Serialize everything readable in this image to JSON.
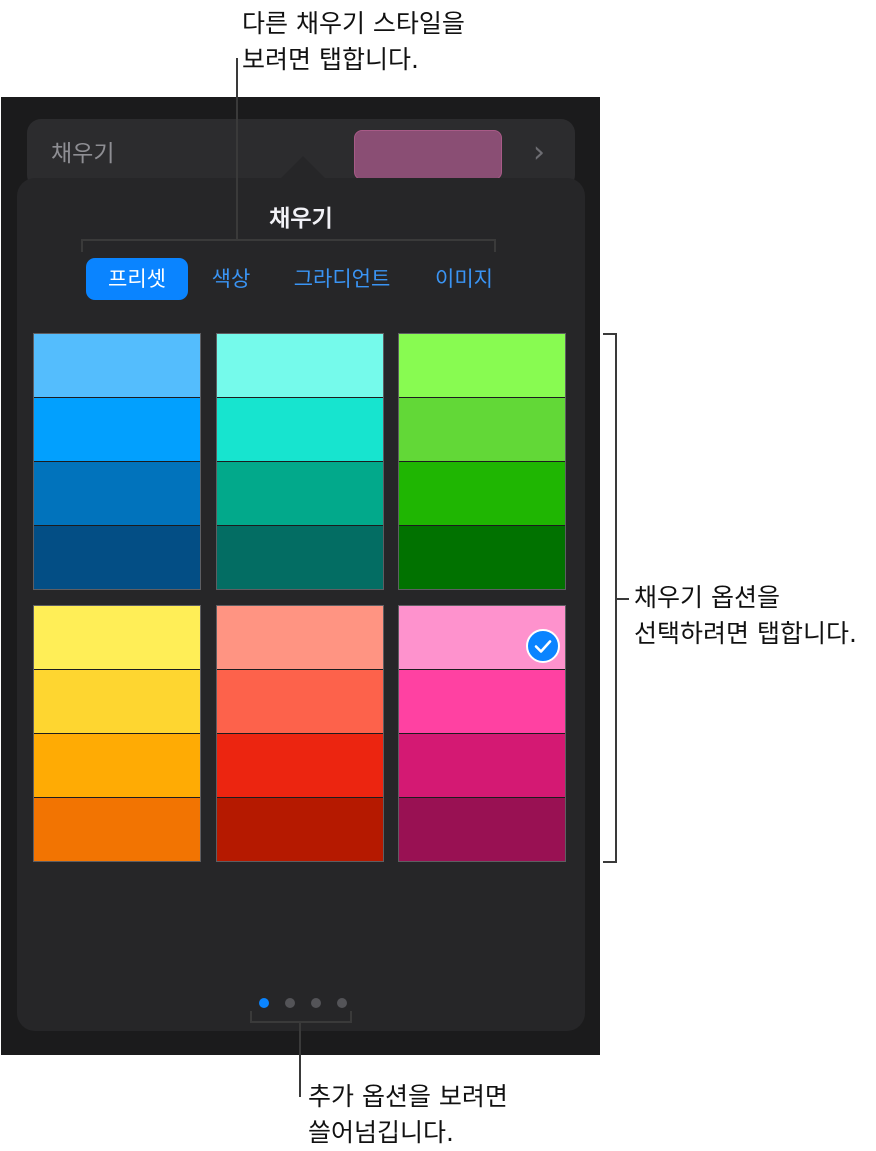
{
  "callouts": {
    "top_line1": "다른 채우기 스타일을",
    "top_line2": "보려면 탭합니다.",
    "right_line1": "채우기 옵션을",
    "right_line2": "선택하려면 탭합니다.",
    "bottom_line1": "추가 옵션을 보려면",
    "bottom_line2": "쓸어넘깁니다."
  },
  "fill_row": {
    "label": "채우기",
    "chevron": "›",
    "preview_color": "#8a4e74"
  },
  "popover": {
    "title": "채우기",
    "tabs": [
      {
        "label": "프리셋",
        "selected": true
      },
      {
        "label": "색상",
        "selected": false
      },
      {
        "label": "그라디언트",
        "selected": false
      },
      {
        "label": "이미지",
        "selected": false
      }
    ]
  },
  "presets": [
    {
      "name": "blue",
      "bands": [
        "#54bdfd",
        "#02a0fe",
        "#0173bc",
        "#034e85"
      ],
      "selected": false
    },
    {
      "name": "teal",
      "bands": [
        "#75faeb",
        "#17e4cf",
        "#02a98b",
        "#036d63"
      ],
      "selected": false
    },
    {
      "name": "green",
      "bands": [
        "#88fb51",
        "#62d837",
        "#1fb602",
        "#017200"
      ],
      "selected": false
    },
    {
      "name": "yellow",
      "bands": [
        "#ffee57",
        "#fed630",
        "#ffab04",
        "#f27402"
      ],
      "selected": false
    },
    {
      "name": "red",
      "bands": [
        "#ff9482",
        "#fd624b",
        "#ec2510",
        "#b51900"
      ],
      "selected": false
    },
    {
      "name": "pink",
      "bands": [
        "#fe92cd",
        "#ff41a2",
        "#d41973",
        "#991153"
      ],
      "selected": true
    }
  ],
  "page_indicator": {
    "count": 4,
    "active_index": 0
  },
  "colors": {
    "accent": "#0a84ff",
    "popover_bg": "#262628",
    "panel_bg": "#1b1b1c"
  }
}
